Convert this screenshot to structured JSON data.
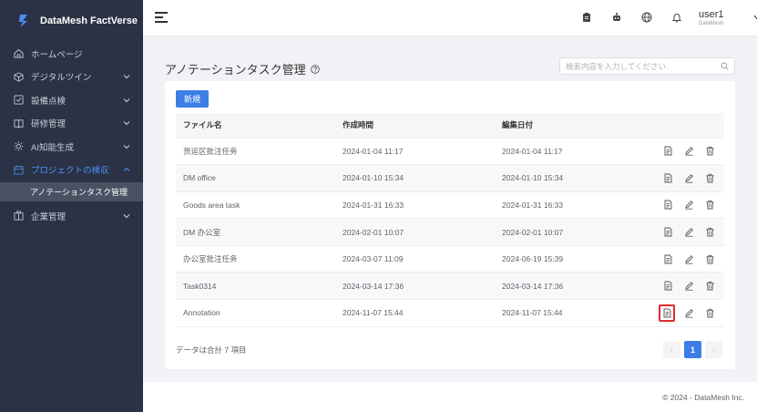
{
  "app": {
    "name": "DataMesh FactVerse"
  },
  "sidebar": {
    "items": [
      {
        "label": "ホームページ",
        "icon": "home-icon",
        "chevron": false
      },
      {
        "label": "デジタルツイン",
        "icon": "cube-icon",
        "chevron": true
      },
      {
        "label": "設備点検",
        "icon": "checkbox-icon",
        "chevron": true
      },
      {
        "label": "研修管理",
        "icon": "book-icon",
        "chevron": true
      },
      {
        "label": "AI知能生成",
        "icon": "ai-icon",
        "chevron": true
      },
      {
        "label": "プロジェクトの検収",
        "icon": "calendar-icon",
        "chevron": true,
        "active": true
      },
      {
        "label": "企業管理",
        "icon": "building-icon",
        "chevron": true
      }
    ],
    "submenu": {
      "label": "アノテーションタスク管理"
    }
  },
  "topbar": {
    "user_name": "user1",
    "user_org": "DataMesh"
  },
  "page": {
    "title": "アノテーションタスク管理",
    "search_placeholder": "検索内容を入力してください",
    "new_button": "新規"
  },
  "table": {
    "headers": [
      "ファイル名",
      "作成時間",
      "編集日付"
    ],
    "rows": [
      {
        "name": "货运区批注任务",
        "created": "2024-01-04 11:17",
        "edited": "2024-01-04 11:17"
      },
      {
        "name": "DM office",
        "created": "2024-01-10 15:34",
        "edited": "2024-01-10 15:34"
      },
      {
        "name": "Goods area task",
        "created": "2024-01-31 16:33",
        "edited": "2024-01-31 16:33"
      },
      {
        "name": "DM 办公室",
        "created": "2024-02-01 10:07",
        "edited": "2024-02-01 10:07"
      },
      {
        "name": "办公室批注任务",
        "created": "2024-03-07 11:09",
        "edited": "2024-06-19 15:39"
      },
      {
        "name": "Task0314",
        "created": "2024-03-14 17:36",
        "edited": "2024-03-14 17:36"
      },
      {
        "name": "Annotation",
        "created": "2024-11-07 15:44",
        "edited": "2024-11-07 15:44",
        "highlight": true
      }
    ]
  },
  "pagination": {
    "total_text": "データは合計 7 項目",
    "current_page": "1",
    "prev": "‹",
    "next": "›"
  },
  "footer": {
    "text": "© 2024 - DataMesh Inc."
  },
  "colors": {
    "sidebar_bg": "#2b3245",
    "accent": "#3d7de8",
    "highlight_border": "#e02a2a"
  }
}
